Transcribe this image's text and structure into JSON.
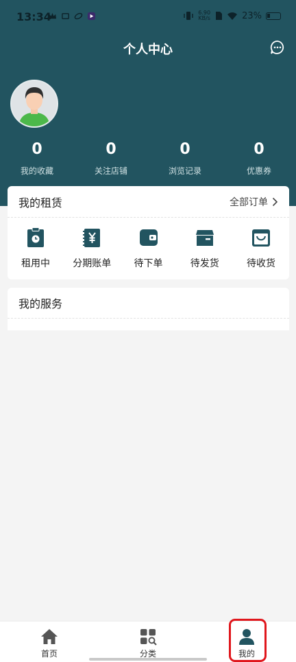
{
  "status_bar": {
    "time": "13:34",
    "speed_top": "6.90",
    "speed_bottom": "KB/s",
    "battery": "23%"
  },
  "header": {
    "title": "个人中心"
  },
  "stats": [
    {
      "value": "0",
      "label": "我的收藏"
    },
    {
      "value": "0",
      "label": "关注店铺"
    },
    {
      "value": "0",
      "label": "浏览记录"
    },
    {
      "value": "0",
      "label": "优惠券"
    }
  ],
  "rent": {
    "title": "我的租赁",
    "all_orders": "全部订单",
    "items": [
      {
        "label": "租用中",
        "icon": "clipboard-clock-icon"
      },
      {
        "label": "分期账单",
        "icon": "yen-bill-icon"
      },
      {
        "label": "待下单",
        "icon": "wallet-icon"
      },
      {
        "label": "待发货",
        "icon": "box-icon"
      },
      {
        "label": "待收货",
        "icon": "bag-icon"
      }
    ]
  },
  "service": {
    "title": "我的服务"
  },
  "tabbar": {
    "items": [
      {
        "label": "首页",
        "icon": "home-icon"
      },
      {
        "label": "分类",
        "icon": "category-icon"
      },
      {
        "label": "我的",
        "icon": "user-icon"
      }
    ],
    "active": "我的"
  },
  "colors": {
    "primary": "#225460",
    "background": "#f4f4f4",
    "highlight": "#e0161c"
  }
}
